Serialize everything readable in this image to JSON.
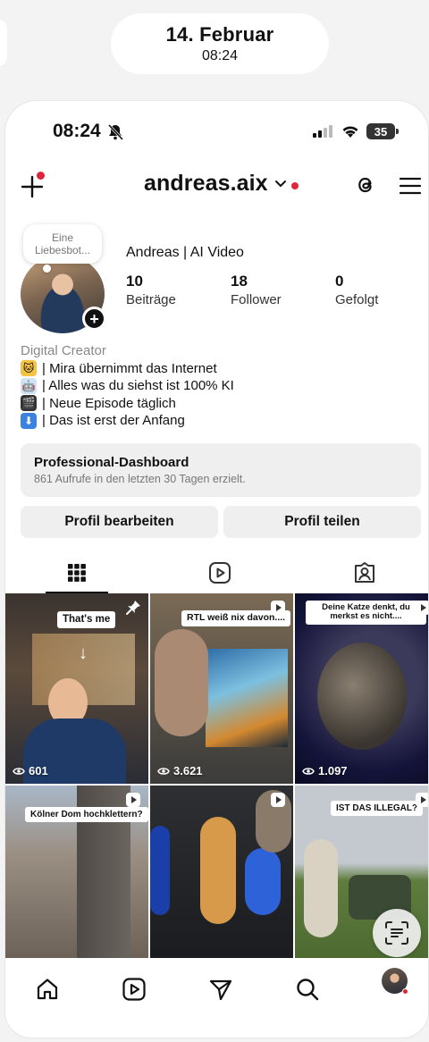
{
  "lockscreen": {
    "date": "14. Februar",
    "time": "08:24"
  },
  "statusbar": {
    "time": "08:24",
    "battery": "35"
  },
  "header": {
    "username": "andreas.aix"
  },
  "profile": {
    "note": "Eine Liebesbot...",
    "display_name": "Andreas | AI Video",
    "stats": [
      {
        "num": "10",
        "label": "Beiträge"
      },
      {
        "num": "18",
        "label": "Follower"
      },
      {
        "num": "0",
        "label": "Gefolgt"
      }
    ],
    "category": "Digital Creator",
    "bio_lines": [
      "| Mira übernimmt das Internet",
      "| Alles was du siehst ist 100% KI",
      "| Neue Episode täglich",
      "| Das ist erst der Anfang"
    ]
  },
  "dashboard": {
    "title": "Professional-Dashboard",
    "subtitle": "861 Aufrufe in den letzten 30 Tagen erzielt."
  },
  "buttons": {
    "edit": "Profil bearbeiten",
    "share": "Profil teilen"
  },
  "posts": [
    {
      "caption": "That's me",
      "views": "601",
      "badge": "pin"
    },
    {
      "caption": "RTL weiß nix davon....",
      "views": "3.621",
      "badge": "reel"
    },
    {
      "caption": "Deine Katze denkt, du merkst es nicht....",
      "views": "1.097",
      "badge": "reel"
    },
    {
      "caption": "Kölner Dom hochklettern?",
      "views": "",
      "badge": "reel"
    },
    {
      "caption": "",
      "views": "",
      "badge": "reel"
    },
    {
      "caption": "IST DAS ILLEGAL?",
      "views": "",
      "badge": "reel"
    }
  ],
  "colors": {
    "notification_red": "#e0243a",
    "button_bg": "#efefef"
  }
}
